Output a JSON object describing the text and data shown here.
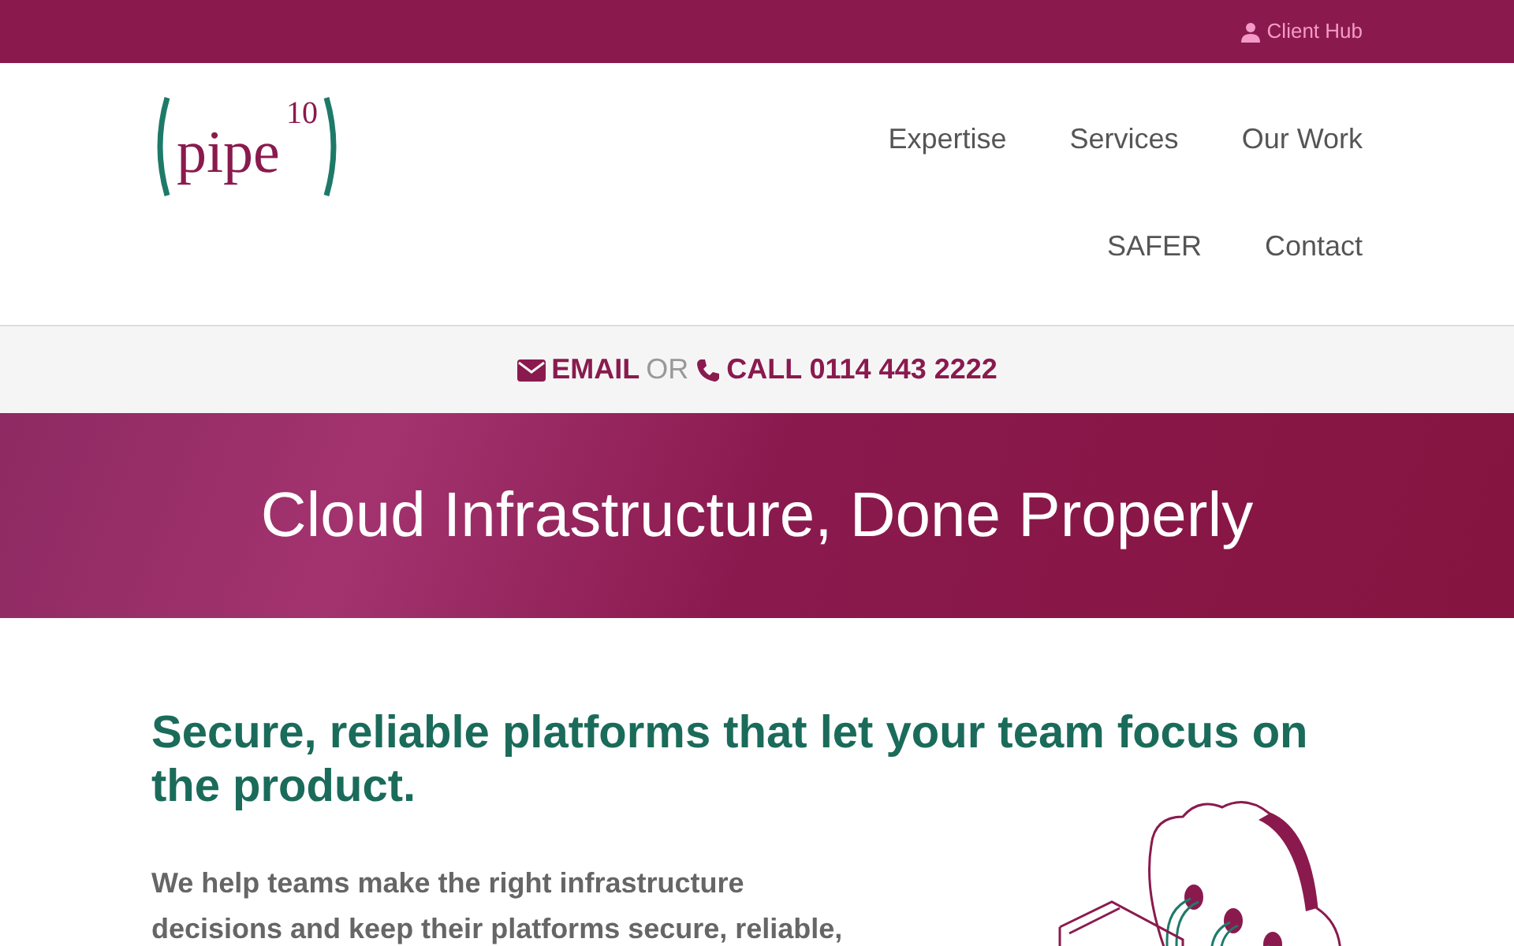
{
  "top_bar": {
    "link": "Client Hub"
  },
  "logo": {
    "word": "pipe",
    "superscript": "10"
  },
  "nav": [
    {
      "label": "Expertise"
    },
    {
      "label": "Services"
    },
    {
      "label": "Our Work"
    },
    {
      "label": "SAFER"
    },
    {
      "label": "Contact"
    }
  ],
  "contact_bar": {
    "email": "EMAIL",
    "separator": "OR",
    "call": "CALL 0114 443 2222"
  },
  "hero": {
    "title": "Cloud Infrastructure, Done Properly"
  },
  "content": {
    "heading": "Secure, reliable platforms that let your team focus on the product.",
    "paragraph": "We help teams make the right infrastructure decisions and keep their platforms secure, reliable,"
  }
}
